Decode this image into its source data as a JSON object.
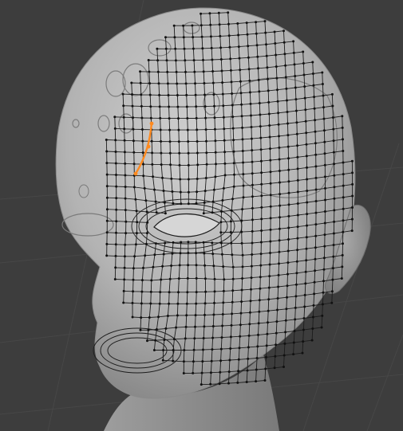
{
  "viewport": {
    "background": "#3d3d3d",
    "grid_color": "#464646",
    "mesh_fill": "#a9a9a9",
    "wire_color": "#1c1c1c",
    "selected_color": "#ff8a1f",
    "object": "head-mesh",
    "mode": "edit-mode-wireframe-overlay"
  }
}
